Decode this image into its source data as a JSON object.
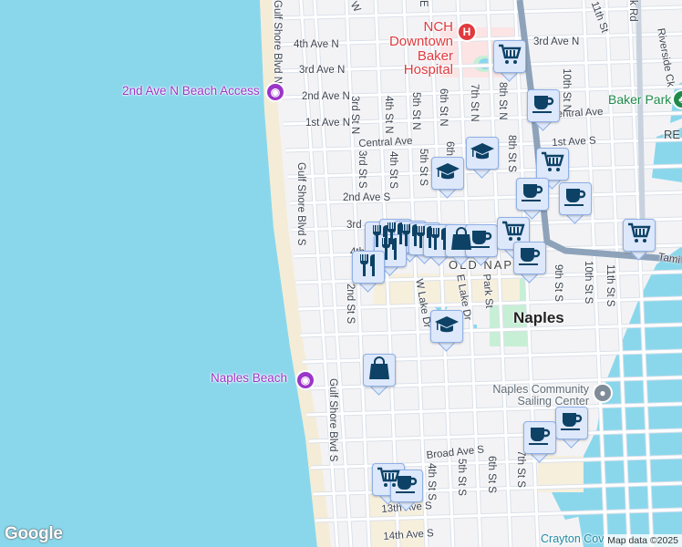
{
  "map": {
    "colors": {
      "water": "#8ad7ec",
      "land": "#f3f3f5",
      "road": "#ffffff",
      "road_edge": "#d7dde6",
      "highway": "#8ea3ba",
      "park": "#c6efd5",
      "beach": "#f4ecd6",
      "hospital": "#fde4e4",
      "marker_bg": "#dde8fb",
      "marker_icon": "#0d4266"
    },
    "streets": [
      "4th Ave N",
      "3rd Ave N",
      "2nd Ave N",
      "1st Ave N",
      "Central Ave",
      "Central Ave",
      "3rd Ave N",
      "1st Ave S",
      "2nd Ave S",
      "3rd",
      "4th",
      "Broad Ave S",
      "13th Ave S",
      "14th Ave S",
      "Gulf Shore Blvd N",
      "Gulf Shore Blvd S",
      "Gulf Shore Blvd S",
      "2nd St S",
      "3rd St N",
      "3rd St S",
      "4th St N",
      "4th St S",
      "5th St N",
      "5th St S",
      "6th St N",
      "6th",
      "7th St N",
      "8th St N",
      "8th St S",
      "10th St N",
      "11th St",
      "9th St S",
      "10th St S",
      "11th St S",
      "4th St S",
      "5th St S",
      "6th St S",
      "7th St S",
      "W Lake Dr",
      "E Lake Dr",
      "Park St",
      "k Rd",
      "Riverside Ck",
      "W",
      "E",
      "Tami"
    ],
    "places": {
      "hospital": "NCH Downtown Baker Hospital",
      "beach_access": "2nd Ave N Beach Access",
      "naples_beach": "Naples Beach",
      "baker_park": "Baker Park",
      "re": "RE",
      "old_naples": "OLD NAPL",
      "naples": "Naples",
      "sailing_center": "Naples Community Sailing Center",
      "crayton_cove": "Crayton Cov"
    },
    "markers": [
      "cart",
      "coffee",
      "grad-cap",
      "grad-cap",
      "cart",
      "coffee",
      "coffee",
      "cart",
      "restaurant",
      "restaurant",
      "restaurant",
      "restaurant",
      "restaurant",
      "restaurant",
      "bag",
      "coffee",
      "cart",
      "coffee",
      "restaurant",
      "grad-cap",
      "bag",
      "coffee",
      "coffee",
      "cart",
      "coffee"
    ],
    "attribution": "Map data ©2025",
    "logo": "Google"
  }
}
